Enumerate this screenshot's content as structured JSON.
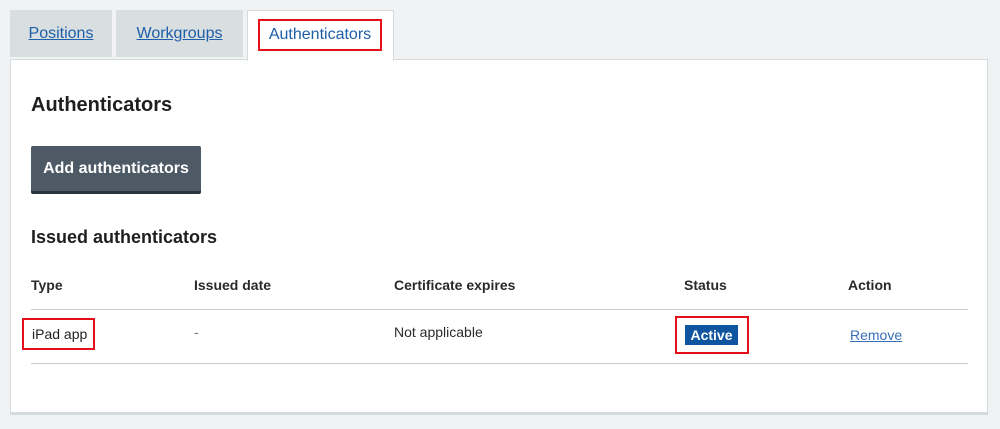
{
  "tabs": [
    {
      "label": "Positions"
    },
    {
      "label": "Workgroups"
    },
    {
      "label": "Authenticators"
    }
  ],
  "page": {
    "title": "Authenticators",
    "add_button_label": "Add authenticators",
    "subtitle": "Issued authenticators"
  },
  "table": {
    "headers": {
      "type": "Type",
      "issued_date": "Issued date",
      "certificate_expires": "Certificate expires",
      "status": "Status",
      "action": "Action"
    },
    "rows": [
      {
        "type": "iPad app",
        "issued_date": "-",
        "certificate_expires": "Not applicable",
        "status": "Active",
        "action": "Remove"
      }
    ]
  },
  "colors": {
    "link": "#1d5fa8",
    "status_active": "#0f55a0",
    "button": "#4d5a66",
    "highlight": "#e3101b"
  }
}
